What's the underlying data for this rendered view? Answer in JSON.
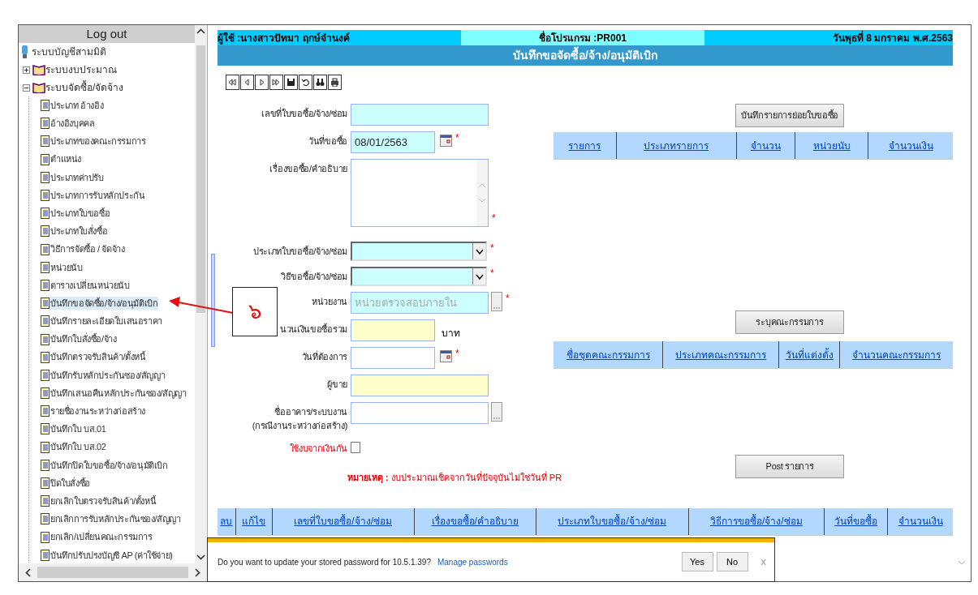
{
  "sidebar": {
    "header": "Log out",
    "root": "ระบบบัญชีสามมิติ",
    "folders": [
      {
        "label": "ระบบงบประมาณ",
        "expanded": false
      },
      {
        "label": "ระบบจัดซื้อ/จัดจ้าง",
        "expanded": true,
        "children": [
          {
            "label": "ประเภท อ้างอิง",
            "selected": false
          },
          {
            "label": "อ้างอิงบุคคล",
            "selected": false
          },
          {
            "label": "ประเภทของคณะกรรมการ",
            "selected": false
          },
          {
            "label": "ตำแหน่ง",
            "selected": false
          },
          {
            "label": "ประเภทค่าปรับ",
            "selected": false
          },
          {
            "label": "ประเภทการรับหลักประกัน",
            "selected": false
          },
          {
            "label": "ประเภทใบขอซื้อ",
            "selected": false
          },
          {
            "label": "ประเภทใบสั่งซื้อ",
            "selected": false
          },
          {
            "label": "วิธีการจัดซื้อ / จัดจ้าง",
            "selected": false
          },
          {
            "label": "หน่วยนับ",
            "selected": false
          },
          {
            "label": "ตารางเปลี่ยนหน่วยนับ",
            "selected": false
          },
          {
            "label": "บันทึกขอจัดซื้อ/จ้าง/อนุมัติเบิก",
            "selected": true
          },
          {
            "label": "บันทึกรายละเอียดใบเสนอราคา",
            "selected": false
          },
          {
            "label": "บันทึกใบสั่งซื้อ/จ้าง",
            "selected": false
          },
          {
            "label": "บันทึกตรวจรับสินค้า/ตั้งหนี้",
            "selected": false
          },
          {
            "label": "บันทึกรับหลักประกันซอง/สัญญา",
            "selected": false
          },
          {
            "label": "บันทึกเสนอคืนหลักประกันซอง/สัญญา",
            "selected": false
          },
          {
            "label": "รายชื่องานระหว่างก่อสร้าง",
            "selected": false
          },
          {
            "label": "บันทึกใบ บส.01",
            "selected": false
          },
          {
            "label": "บันทึกใบ บส.02",
            "selected": false
          },
          {
            "label": "บันทึกปิดใบขอซื้อ/จ้าง/อนุมัติเบิก",
            "selected": false
          },
          {
            "label": "ปิดใบสั่งซื้อ",
            "selected": false
          },
          {
            "label": "ยกเลิกใบตรวจรับสินค้า/ตั้งหนี้",
            "selected": false
          },
          {
            "label": "ยกเลิกการรับหลักประกันซอง/สัญญา",
            "selected": false
          },
          {
            "label": "ยกเลิก/เปลี่ยนคณะกรรมการ",
            "selected": false
          },
          {
            "label": "บันทึกปรับปรงบัญชี AP (ค่าใช้จ่าย)",
            "selected": false
          }
        ]
      }
    ]
  },
  "header": {
    "user": "ผู้ใช้ :นางสาวปัทมา ฤกษ์จำนงค์",
    "program": "ชื่อโปรแกรม :PR001",
    "date": "วันพุธที่ 8 มกราคม พ.ศ.2563",
    "title": "บันทึกขอจัดซื้อ/จ้าง/อนุมัติเบิก"
  },
  "form": {
    "fields": [
      {
        "kind": "text",
        "label": "เลขที่ใบขอซื้อ/จ้าง/ซ่อม",
        "color": "#ccffff"
      },
      {
        "kind": "date",
        "label": "วันที่ขอซื้อ",
        "value": "08/01/2563",
        "color": "#ccffff",
        "marker": "*"
      },
      {
        "kind": "textarea",
        "label": "เรื่องขอซื้อ/คำอธิบาย",
        "color": "#ffffff",
        "marker": "*"
      },
      {
        "kind": "select",
        "label": "ประเภทใบขอซื้อ/จ้าง/ซ่อม",
        "color": "#ccffff",
        "marker": "*"
      },
      {
        "kind": "select",
        "label": "วิธีขอซื้อ/จ้าง/ซ่อม",
        "color": "#ccffff",
        "marker": "*"
      },
      {
        "kind": "lookup",
        "label": "หน่วยงาน",
        "placeholder": "หน่วยตรวจสอบภายใน",
        "color": "#ccffff",
        "marker": "*"
      },
      {
        "kind": "text",
        "label": "นวนเงินขอซื้อรวม",
        "suffix": "บาท",
        "color": "#ffffcc"
      },
      {
        "kind": "date",
        "label": "วันที่ต้องการ",
        "color": "#ffffff",
        "marker": "*"
      },
      {
        "kind": "wide",
        "label": "ผู้ขาย",
        "color": "#ffffcc"
      },
      {
        "kind": "lookup",
        "label": "ชื่ออาคาร/ระบบงาน",
        "label2": "(กรณีงานระหว่างก่อสร้าง)",
        "color": "#ffffff"
      },
      {
        "kind": "checkbox",
        "label": "ใช้งบจากเงินกัน",
        "checked": false
      }
    ],
    "note_label": "หมายเหตุ :",
    "note": "งบประมาณเช็คจากวันที่ปัจจุบันไม่ใช่วันที่ PR"
  },
  "items": {
    "button": "บันทึกรายการย่อยใบขอซื้อ",
    "columns": [
      "รายการ",
      "ประเภทรายการ",
      "จำนวน",
      "หน่วยนับ",
      "จำนวนเงิน"
    ]
  },
  "committee": {
    "button": "ระบุคณะกรรมการ",
    "columns": [
      "ชื่อชุดคณะกรรมการ",
      "ประเภทคณะกรรมการ",
      "วันที่แต่งตั้ง",
      "จำนวนคณะกรรมการ"
    ]
  },
  "post_button": "Post รายการ",
  "list": {
    "columns": [
      "ลบ",
      "แก้ไข",
      "เลขที่ใบขอซื้อ/จ้าง/ซ่อม",
      "เรื่องขอซื้อ/คำอธิบาย",
      "ประเภทใบขอซื้อ/จ้าง/ซ่อม",
      "วิธีการขอซื้อ/จ้าง/ซ่อม",
      "วันที่ขอซื้อ",
      "จำนวนเงิน"
    ]
  },
  "password_bar": {
    "message": "Do you want to update your stored password for 10.5.1.39?",
    "link": "Manage passwords",
    "buttons": [
      "Yes",
      "No"
    ],
    "close": "x"
  },
  "callout": {
    "text": "๖"
  }
}
